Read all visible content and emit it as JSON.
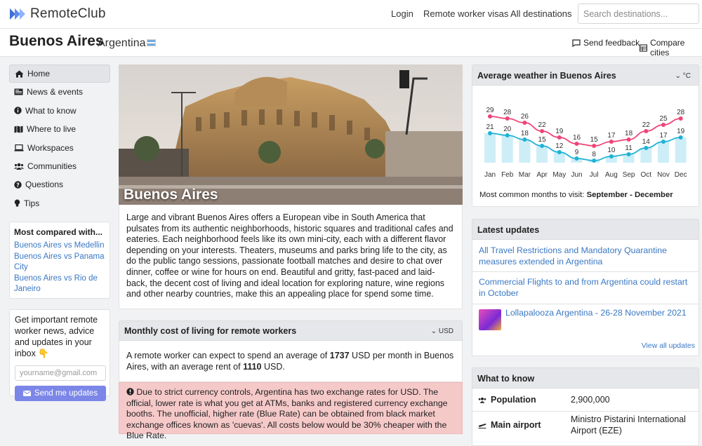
{
  "brand": {
    "name": "RemoteClub"
  },
  "nav": {
    "login": "Login",
    "visas": "Remote worker visas",
    "destinations": "All destinations"
  },
  "search": {
    "placeholder": "Search destinations..."
  },
  "header": {
    "city": "Buenos Aires",
    "country": "Argentina",
    "send_feedback": "Send feedback",
    "compare_cities": "Compare cities"
  },
  "sidebar": {
    "items": [
      {
        "label": "Home",
        "icon": "home-icon"
      },
      {
        "label": "News & events",
        "icon": "newspaper-icon"
      },
      {
        "label": "What to know",
        "icon": "info-icon"
      },
      {
        "label": "Where to live",
        "icon": "map-icon"
      },
      {
        "label": "Workspaces",
        "icon": "laptop-icon"
      },
      {
        "label": "Communities",
        "icon": "users-icon"
      },
      {
        "label": "Questions",
        "icon": "question-icon"
      },
      {
        "label": "Tips",
        "icon": "lightbulb-icon"
      }
    ]
  },
  "compared": {
    "title": "Most compared with...",
    "links": [
      "Buenos Aires vs Medellin",
      "Buenos Aires vs Panama City",
      "Buenos Aires vs Rio de Janeiro"
    ]
  },
  "newsletter": {
    "text": "Get important remote worker news, advice and updates in your inbox 👇",
    "email_placeholder": "yourname@gmail.com",
    "button": "Send me updates"
  },
  "hero": {
    "label": "Buenos Aires"
  },
  "description": "Large and vibrant Buenos Aires offers a European vibe in South America that pulsates from its authentic neighborhoods, historic squares and traditional cafes and eateries. Each neighborhood feels like its own mini-city, each with a different flavor depending on your interests. Theaters, museums and parks bring life to the city, as do the public tango sessions, passionate football matches and desire to chat over dinner, coffee or wine for hours on end. Beautiful and gritty, fast-paced and laid-back, the decent cost of living and ideal location for exploring nature, wine regions and other nearby countries, make this an appealing place for spend some time.",
  "cost": {
    "title": "Monthly cost of living for remote workers",
    "currency": "USD",
    "text_1": "A remote worker can expect to spend an average of ",
    "average": "1737",
    "text_2": " USD per month in Buenos Aires, with an average rent of ",
    "rent": "1110",
    "text_3": " USD.",
    "alert": "Due to strict currency controls, Argentina has two exchange rates for USD. The official, lower rate is what you get at ATMs, banks and registered currency exchange booths. The unofficial, higher rate (Blue Rate) can be obtained from black market exchange offices known as 'cuevas'. All costs below would be 30% cheaper with the Blue Rate."
  },
  "weather": {
    "title": "Average weather in Buenos Aires",
    "unit": "°C",
    "best_label": "Most common months to visit: ",
    "best_months": "September - December"
  },
  "chart_data": {
    "type": "line",
    "categories": [
      "Jan",
      "Feb",
      "Mar",
      "Apr",
      "May",
      "Jun",
      "Jul",
      "Aug",
      "Sep",
      "Oct",
      "Nov",
      "Dec"
    ],
    "series": [
      {
        "values": [
          29,
          28,
          26,
          22,
          19,
          16,
          15,
          17,
          18,
          22,
          25,
          28
        ],
        "color": "#ee4477"
      },
      {
        "values": [
          21,
          20,
          18,
          15,
          12,
          9,
          8,
          10,
          11,
          14,
          17,
          19
        ],
        "color": "#1fb2d6"
      }
    ],
    "bar_color": "#cdeef7"
  },
  "updates": {
    "title": "Latest updates",
    "items": [
      "All Travel Restrictions and Mandatory Quarantine measures extended in Argentina",
      "Commercial Flights to and from Argentina could restart in October",
      "Lollapalooza Argentina - 26-28 November 2021"
    ],
    "view_all": "View all updates"
  },
  "know": {
    "title": "What to know",
    "rows": [
      {
        "label": "Population",
        "value": "2,900,000",
        "icon": "users-icon"
      },
      {
        "label": "Main airport",
        "value": "Ministro Pistarini International Airport (EZE)",
        "icon": "plane-icon"
      }
    ]
  }
}
